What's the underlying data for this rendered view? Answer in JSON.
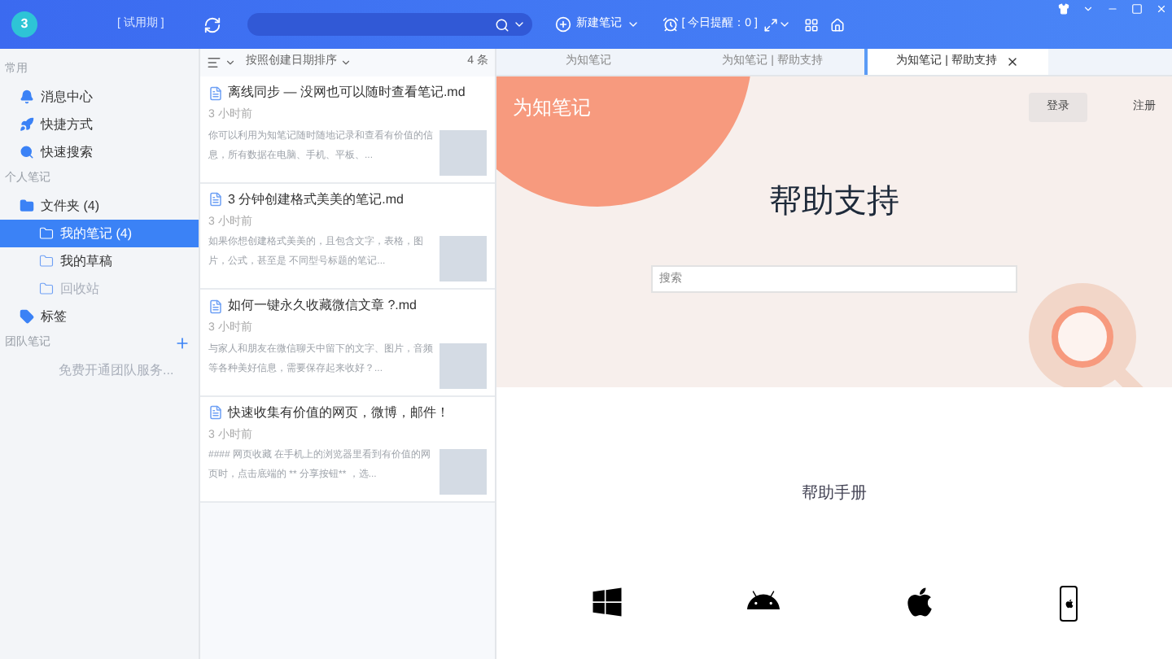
{
  "header": {
    "avatar": "3",
    "trial": "[ 试用期 ]",
    "new_note": "新建笔记",
    "reminder": "[ 今日提醒：0 ]"
  },
  "sidebar": {
    "sections": [
      {
        "title": "常用",
        "items": [
          {
            "label": "消息中心",
            "kind": "bell",
            "selected": false,
            "disabled": false
          },
          {
            "label": "快捷方式",
            "kind": "rocket",
            "selected": false,
            "disabled": false
          },
          {
            "label": "快速搜索",
            "kind": "search",
            "selected": false,
            "disabled": false
          }
        ]
      },
      {
        "title": "个人笔记",
        "items": [
          {
            "label": "文件夹 (4)",
            "kind": "folder",
            "selected": false,
            "disabled": false,
            "children": [
              {
                "label": "我的笔记 (4)",
                "kind": "folder",
                "selected": true,
                "disabled": false
              },
              {
                "label": "我的草稿",
                "kind": "folder",
                "selected": false,
                "disabled": false
              },
              {
                "label": "回收站",
                "kind": "folder",
                "selected": false,
                "disabled": true
              }
            ]
          },
          {
            "label": "标签",
            "kind": "tag",
            "selected": false,
            "disabled": false
          }
        ]
      },
      {
        "title": "团队笔记",
        "add": true,
        "items": [
          {
            "label": "免费开通团队服务...",
            "kind": "text",
            "selected": false,
            "disabled": true
          }
        ]
      }
    ]
  },
  "note_list": {
    "sort": "按照创建日期排序",
    "count": "4 条",
    "notes": [
      {
        "title": "离线同步 — 没网也可以随时查看笔记.md",
        "time": "3 小时前",
        "snippet": "你可以利用为知笔记随时随地记录和查看有价值的信息，所有数据在电脑、手机、平板、..."
      },
      {
        "title": "3 分钟创建格式美美的笔记.md",
        "time": "3 小时前",
        "snippet": "如果你想创建格式美美的，且包含文字，表格，图片，公式，甚至是 不同型号标题的笔记..."
      },
      {
        "title": "如何一键永久收藏微信文章 ?.md",
        "time": "3 小时前",
        "snippet": " 与家人和朋友在微信聊天中留下的文字、图片，音频等各种美好信息，需要保存起来收好？..."
      },
      {
        "title": "快速收集有价值的网页，微博，邮件！",
        "time": "3 小时前",
        "snippet": " #### 网页收藏 在手机上的浏览器里看到有价值的网页时，点击底端的 ** 分享按钮** ，选..."
      }
    ]
  },
  "tabs": [
    {
      "label": "为知笔记",
      "selected": false,
      "closable": false
    },
    {
      "label": "为知笔记 | 帮助支持",
      "selected": false,
      "closable": false
    },
    {
      "label": "为知笔记 | 帮助支持",
      "selected": true,
      "closable": true
    }
  ],
  "page": {
    "logo": "为知笔记",
    "login": "登录",
    "register": "注册",
    "title": "帮助支持",
    "search": {
      "placeholder": "搜索"
    },
    "manual": "帮助手册",
    "platforms": [
      {
        "kind": "windows"
      },
      {
        "kind": "android"
      },
      {
        "kind": "apple"
      },
      {
        "kind": "ios"
      }
    ]
  }
}
